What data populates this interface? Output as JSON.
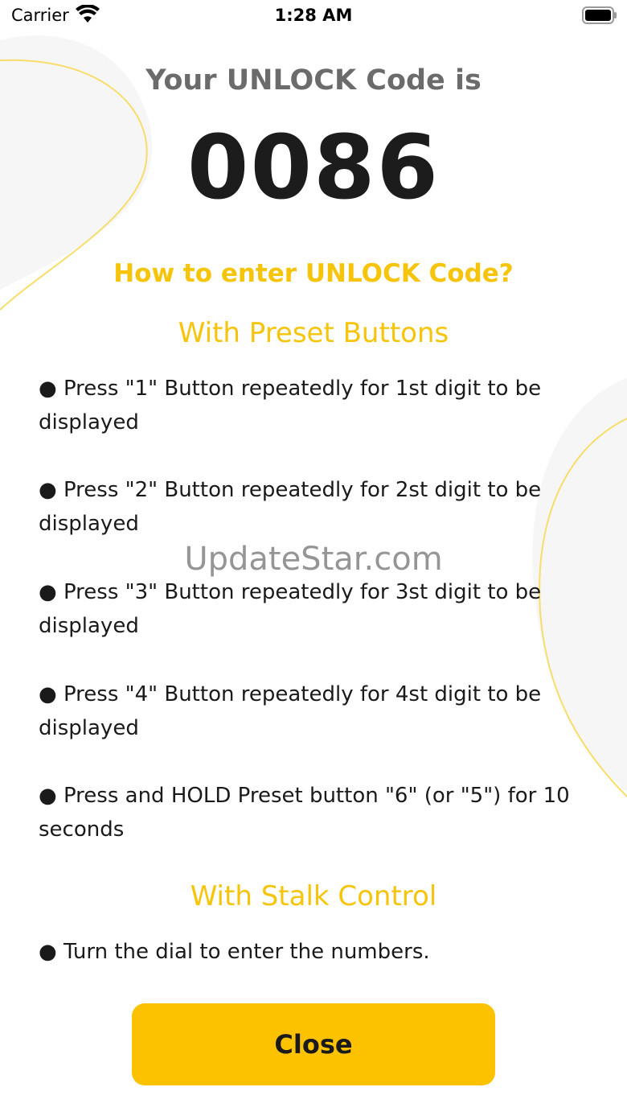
{
  "status_bar": {
    "carrier": "Carrier",
    "time": "1:28 AM",
    "wifi_icon": "wifi-icon",
    "battery_icon": "battery-icon"
  },
  "unlock": {
    "heading": "Your UNLOCK Code is",
    "code": "0086"
  },
  "howto_title": "How to enter UNLOCK Code?",
  "preset_section": {
    "title": "With Preset Buttons",
    "items": [
      "● Press \"1\" Button repeatedly for 1st digit to be displayed",
      "● Press \"2\" Button repeatedly for 2st digit to be displayed",
      "● Press \"3\" Button repeatedly for 3st digit to be displayed",
      "● Press \"4\" Button repeatedly for 4st digit to be displayed",
      "● Press and HOLD Preset button \"6\" (or \"5\") for 10 seconds"
    ]
  },
  "stalk_section": {
    "title": "With Stalk Control",
    "items": [
      "● Turn the dial to enter the numbers."
    ]
  },
  "watermark": "UpdateStar.com",
  "close_button": {
    "label": "Close"
  },
  "colors": {
    "accent_yellow": "#f6c40a",
    "button_yellow": "#fcc200",
    "heading_gray": "#6b6b6b",
    "code_dark": "#1c1c1c"
  }
}
